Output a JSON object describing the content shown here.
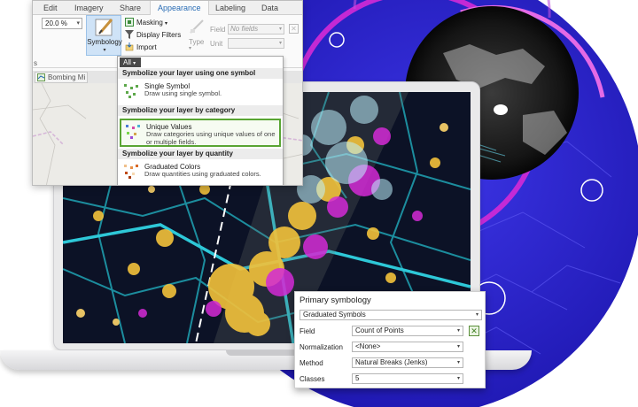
{
  "ribbon": {
    "tabs": [
      "Edit",
      "Imagery",
      "Share",
      "Appearance",
      "Labeling",
      "Data"
    ],
    "active_tab": "Appearance",
    "left_group_suffix": "s",
    "zoom_value": "20.0  %",
    "symbology_label": "Symbology",
    "masking_label": "Masking",
    "display_filters_label": "Display Filters",
    "import_label": "Import",
    "field_label": "Field",
    "field_value": "No fields",
    "type_label": "Type",
    "unit_label": "Unit",
    "group_suffix": "on",
    "doc_tab_label": "Bombing Mi"
  },
  "gallery": {
    "filter_label": "All",
    "sections": [
      {
        "heading": "Symbolize your layer using one symbol",
        "items": [
          {
            "title": "Single Symbol",
            "description": "Draw using single symbol."
          }
        ]
      },
      {
        "heading": "Symbolize your layer by category",
        "items": [
          {
            "title": "Unique Values",
            "description": "Draw categories using unique values of one or multiple fields."
          }
        ]
      },
      {
        "heading": "Symbolize your layer by quantity",
        "items": [
          {
            "title": "Graduated Colors",
            "description": "Draw quantities using graduated colors."
          }
        ]
      }
    ]
  },
  "symbology_pane": {
    "header": "Primary symbology",
    "method_type": "Graduated Symbols",
    "field_label": "Field",
    "field_value": "Count of Points",
    "normalization_label": "Normalization",
    "normalization_value": "<None>",
    "method_label": "Method",
    "method_value": "Natural Breaks (Jenks)",
    "classes_label": "Classes",
    "classes_value": "5"
  },
  "colors": {
    "accent_blue": "#2a6db5",
    "selection_green": "#59a533",
    "globe_blue": "#2b24c8",
    "magenta": "#d42ad6",
    "map_yellow": "#f3c23b",
    "map_cyan": "#5fd7e6"
  }
}
